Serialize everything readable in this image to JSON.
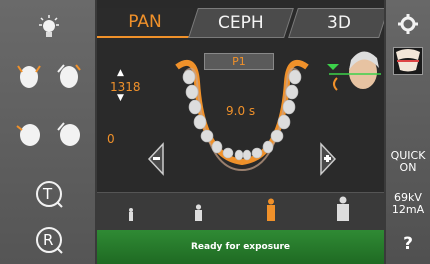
{
  "tabs": [
    {
      "label": "PAN",
      "active": true
    },
    {
      "label": "CEPH",
      "active": false
    },
    {
      "label": "3D",
      "active": false
    }
  ],
  "program": {
    "label": "P1"
  },
  "readouts": {
    "kv_top": "1318",
    "bottom": "0",
    "time": "9.0 s"
  },
  "status": {
    "text": "Ready for exposure",
    "color": "#2f8a34"
  },
  "right_panel": {
    "quick": "QUICK",
    "on": "ON",
    "kv": "69kV",
    "ma": "12mA",
    "help": "?"
  },
  "left_panel": {
    "t_label": "T",
    "r_label": "R"
  },
  "colors": {
    "accent": "#f0912a",
    "status_green": "#2f8a34"
  },
  "icons": [
    "light-icon",
    "head-tilt-icon",
    "head-rotate-icon",
    "timer-icon",
    "reset-icon",
    "settings-icon",
    "preview-icon"
  ]
}
